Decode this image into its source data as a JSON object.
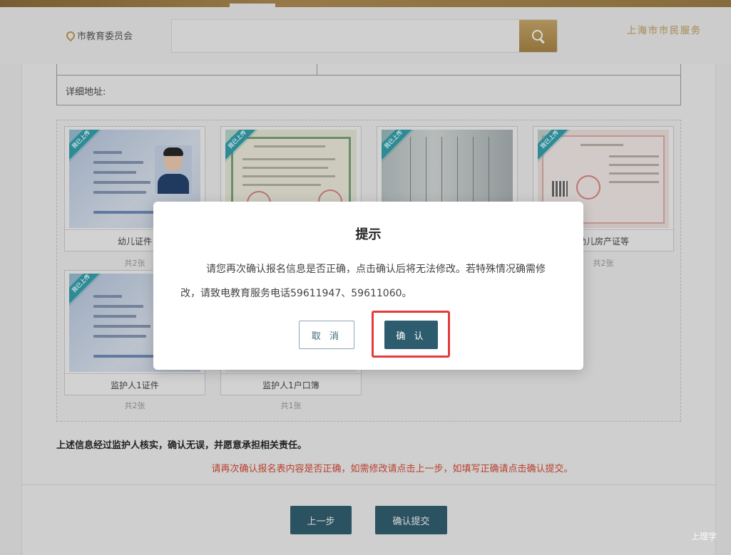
{
  "header": {
    "location": "市教育委员会",
    "search_placeholder": "",
    "brand_name": "上海市市民服务"
  },
  "address": {
    "label": "详细地址:"
  },
  "documents": [
    {
      "label": "幼儿证件",
      "count": "共2张",
      "badge": "我已上传"
    },
    {
      "label": "",
      "count": "",
      "badge": "我已上传"
    },
    {
      "label": "",
      "count": "",
      "badge": "我已上传"
    },
    {
      "label": "幼儿房产证等",
      "count": "共2张",
      "badge": "我已上传"
    },
    {
      "label": "监护人1证件",
      "count": "共2张",
      "badge": "我已上传"
    },
    {
      "label": "监护人1户口簿",
      "count": "共1张",
      "badge": ""
    }
  ],
  "declaration": "上述信息经过监护人核实，确认无误，并愿意承担相关责任。",
  "warning": "请再次确认报名表内容是否正确，如需修改请点击上一步，如填写正确请点击确认提交。",
  "buttons": {
    "prev": "上一步",
    "submit": "确认提交"
  },
  "modal": {
    "title": "提示",
    "body": "请您再次确认报名信息是否正确，点击确认后将无法修改。若特殊情况确需修改，请致电教育服务电话59611947、59611060。",
    "cancel": "取 消",
    "confirm": "确 认"
  },
  "watermark": "上理学",
  "colors": {
    "accent_gold": "#b08c4f",
    "primary_teal": "#2d5c6e",
    "warning_red": "#d9462f",
    "highlight_red": "#e53b3b",
    "badge_teal": "#2e8a94"
  }
}
